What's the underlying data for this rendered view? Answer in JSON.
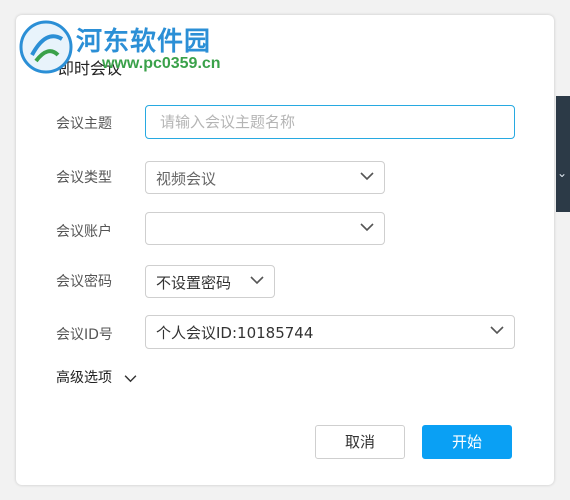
{
  "dialog": {
    "title": "即时会议"
  },
  "watermark": {
    "site_name": "河东软件园",
    "url": "www.pc0359.cn"
  },
  "form": {
    "topic": {
      "label": "会议主题",
      "value": "",
      "placeholder": "请输入会议主题名称"
    },
    "type": {
      "label": "会议类型",
      "value": "视频会议"
    },
    "account": {
      "label": "会议账户",
      "value": ""
    },
    "password": {
      "label": "会议密码",
      "value": "不设置密码"
    },
    "meeting_id": {
      "label": "会议ID号",
      "value": "个人会议ID:10185744"
    }
  },
  "advanced": {
    "label": "高级选项"
  },
  "buttons": {
    "cancel": "取消",
    "start": "开始"
  },
  "colors": {
    "accent": "#0aa0f4",
    "focus_border": "#27a9e1"
  }
}
